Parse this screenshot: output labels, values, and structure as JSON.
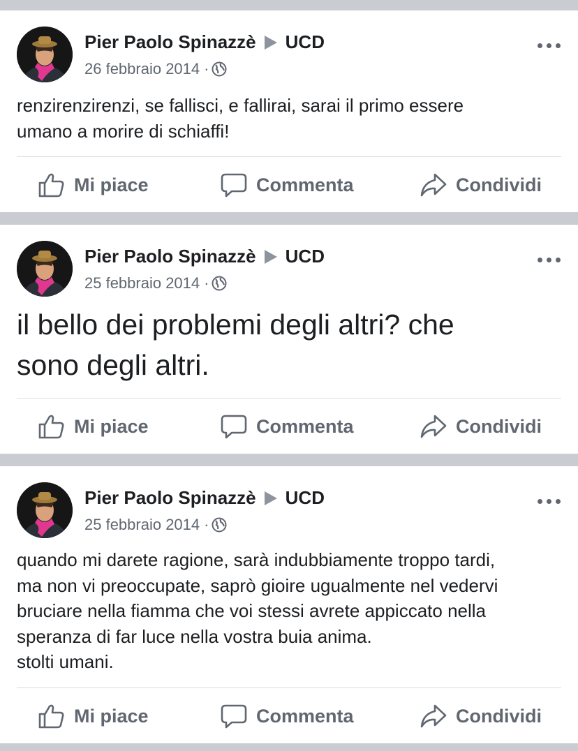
{
  "posts": [
    {
      "author": "Pier Paolo Spinazzè",
      "target": "UCD",
      "date": "26 febbraio 2014",
      "separator": "·",
      "privacy_icon": "globe-icon",
      "text": "renzirenzirenzi, se fallisci, e fallirai, sarai il primo essere\numano a morire di schiaffi!",
      "large_text": false
    },
    {
      "author": "Pier Paolo Spinazzè",
      "target": "UCD",
      "date": "25 febbraio 2014",
      "separator": "·",
      "privacy_icon": "globe-icon",
      "text": "il bello dei problemi degli altri? che\nsono degli altri.",
      "large_text": true
    },
    {
      "author": "Pier Paolo Spinazzè",
      "target": "UCD",
      "date": "25 febbraio 2014",
      "separator": "·",
      "privacy_icon": "globe-icon",
      "text": "quando mi darete ragione, sarà indubbiamente troppo tardi,\nma non vi preoccupate, saprò gioire ugualmente nel vedervi\nbruciare nella fiamma che voi stessi avrete appiccato nella\nsperanza di far luce nella vostra buia anima.\nstolti umani.",
      "large_text": false
    }
  ],
  "actions": {
    "like": "Mi piace",
    "comment": "Commenta",
    "share": "Condividi"
  },
  "colors": {
    "background": "#c9ccd1",
    "card": "#ffffff",
    "primary_text": "#1c1e21",
    "secondary_text": "#606770",
    "divider": "#dadde1"
  }
}
